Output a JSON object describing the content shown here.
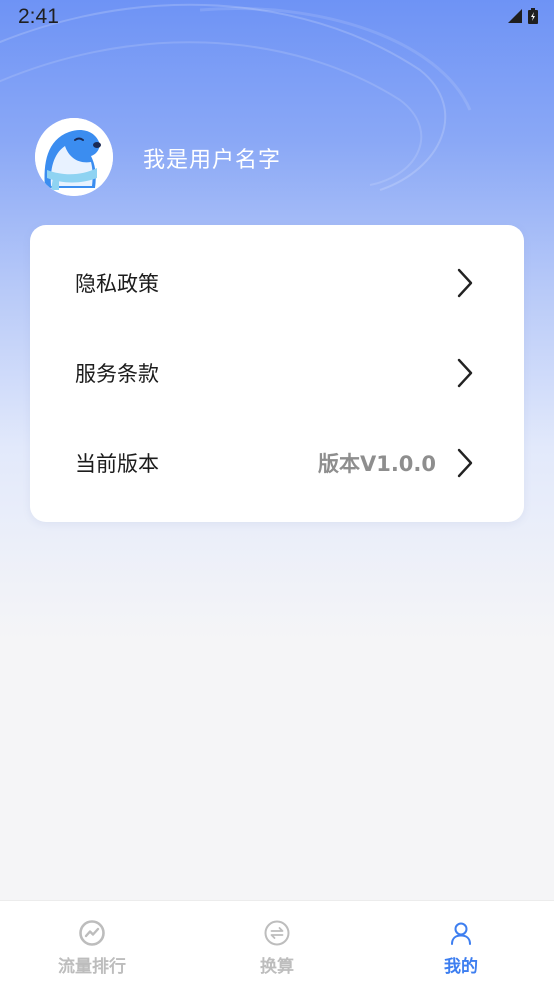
{
  "status_bar": {
    "time": "2:41",
    "icons": [
      "signal-icon",
      "battery-icon"
    ]
  },
  "profile": {
    "username": "我是用户名字",
    "avatar_icon": "seal-mascot-avatar"
  },
  "menu": {
    "items": [
      {
        "label": "隐私政策",
        "value": "",
        "icon": "chevron-right-icon"
      },
      {
        "label": "服务条款",
        "value": "",
        "icon": "chevron-right-icon"
      },
      {
        "label": "当前版本",
        "value": "版本V1.0.0",
        "icon": "chevron-right-icon"
      }
    ]
  },
  "tabbar": {
    "tabs": [
      {
        "label": "流量排行",
        "icon": "trend-chart-icon",
        "active": false
      },
      {
        "label": "换算",
        "icon": "exchange-icon",
        "active": false
      },
      {
        "label": "我的",
        "icon": "user-icon",
        "active": true
      }
    ]
  },
  "colors": {
    "accent": "#3d7ef0",
    "header_gradient_top": "#6e93f5",
    "inactive_tab": "#bdbdbd",
    "page_bg": "#f5f5f7"
  }
}
